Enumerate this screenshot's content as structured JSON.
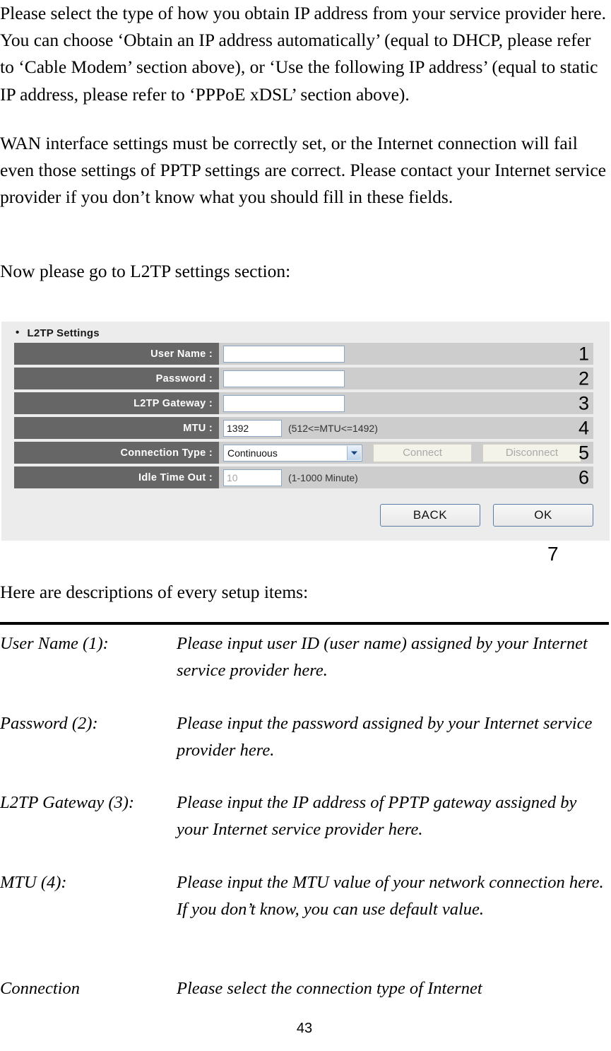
{
  "document": {
    "paragraphs": [
      "Please select the type of how you obtain IP address from your service provider here. You can choose ‘Obtain an IP address automatically’ (equal to DHCP, please refer to ‘Cable Modem’ section above), or ‘Use the following IP address’ (equal to static IP address, please refer to ‘PPPoE xDSL’ section above).",
      "WAN interface settings must be correctly set, or the Internet connection will fail even those settings of PPTP settings are correct. Please contact your Internet service provider if you don’t know what you should fill in these fields.",
      "Now please go to L2TP settings section:",
      "Here are descriptions of every setup items:"
    ],
    "page_number": "43"
  },
  "router_ui": {
    "section_title": "L2TP Settings",
    "bullet_glyph": "•",
    "rows": [
      {
        "label": "User Name :",
        "value": "",
        "hint": "",
        "callout": "1"
      },
      {
        "label": "Password :",
        "value": "",
        "hint": "",
        "callout": "2"
      },
      {
        "label": "L2TP Gateway :",
        "value": "",
        "hint": "",
        "callout": "3"
      },
      {
        "label": "MTU :",
        "value": "1392",
        "hint": "(512<=MTU<=1492)",
        "callout": "4"
      },
      {
        "label": "Connection Type :",
        "value": "Continuous",
        "hint": "",
        "callout": "5"
      },
      {
        "label": "Idle Time Out :",
        "value": "10",
        "hint": "(1-1000 Minute)",
        "callout": "6"
      }
    ],
    "connection_type_options": [
      "Continuous"
    ],
    "connect_button": "Connect",
    "disconnect_button": "Disconnect",
    "back_button": "BACK",
    "ok_button": "OK",
    "footer_callout": "7",
    "colors": {
      "panel_bg": "#ececec",
      "row_bg": "#cdcdcd",
      "label_bg": "#666666",
      "label_text": "#ffffff",
      "input_border": "#8ba7c4",
      "button_border": "#5b7da3",
      "disabled_text": "#a9a9a9"
    }
  },
  "descriptions": [
    {
      "term": "User Name (1):",
      "text": "Please input user ID (user name) assigned by your Internet service provider here."
    },
    {
      "term": "Password (2):",
      "text": "Please input the password assigned by your Internet service provider here."
    },
    {
      "term": "L2TP Gateway (3):",
      "text": "Please input the IP address of PPTP gateway assigned by your Internet service provider here."
    },
    {
      "term": "MTU (4):",
      "text": "Please input the MTU value of your network connection here. If you don’t know, you can use default value."
    },
    {
      "term": "Connection",
      "text": "Please select the connection type of Internet"
    }
  ]
}
